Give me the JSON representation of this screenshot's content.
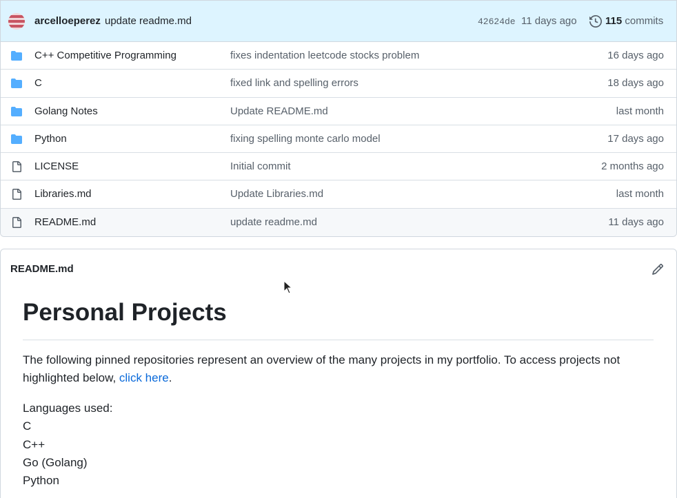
{
  "commit": {
    "author": "arcelloeperez",
    "message": "update readme.md",
    "sha": "42624de",
    "age": "11 days ago",
    "count": "115",
    "count_label": "commits"
  },
  "files": [
    {
      "type": "folder",
      "name": "C++ Competitive Programming",
      "message": "fixes indentation leetcode stocks problem",
      "age": "16 days ago"
    },
    {
      "type": "folder",
      "name": "C",
      "message": "fixed link and spelling errors",
      "age": "18 days ago"
    },
    {
      "type": "folder",
      "name": "Golang Notes",
      "message": "Update README.md",
      "age": "last month"
    },
    {
      "type": "folder",
      "name": "Python",
      "message": "fixing spelling monte carlo model",
      "age": "17 days ago"
    },
    {
      "type": "file",
      "name": "LICENSE",
      "message": "Initial commit",
      "age": "2 months ago"
    },
    {
      "type": "file",
      "name": "Libraries.md",
      "message": "Update Libraries.md",
      "age": "last month"
    },
    {
      "type": "file",
      "name": "README.md",
      "message": "update readme.md",
      "age": "11 days ago"
    }
  ],
  "readme": {
    "header": "README.md",
    "title": "Personal Projects",
    "para_before": "The following pinned repositories represent an overview of the many projects in my portfolio. To access projects not highlighted below, ",
    "link_text": "click here",
    "para_after": ".",
    "languages_heading": "Languages used:",
    "languages": [
      "C",
      "C++",
      "Go (Golang)",
      "Python"
    ]
  },
  "colors": {
    "folder": "#54aeff",
    "file": "#57606a",
    "link": "#0969da",
    "commit_bar": "#ddf4ff"
  }
}
